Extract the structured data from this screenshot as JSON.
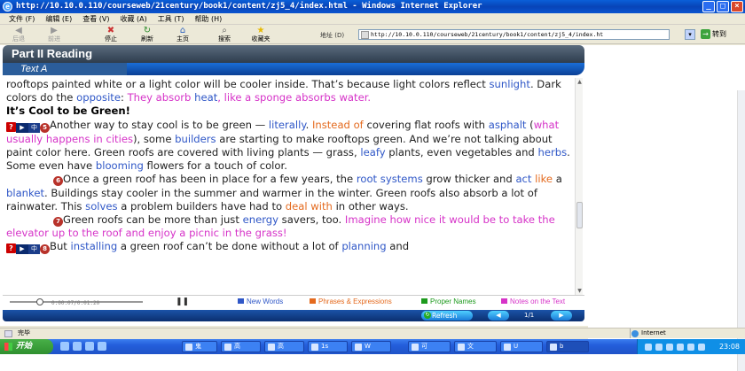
{
  "window": {
    "title": "http://10.10.0.110/courseweb/21century/book1/content/zj5_4/index.html - Windows Internet Explorer"
  },
  "menu": [
    "文件 (F)",
    "编辑 (E)",
    "查看 (V)",
    "收藏 (A)",
    "工具 (T)",
    "帮助 (H)"
  ],
  "toolbar": {
    "back": "后退",
    "forward": "前进",
    "stop": "停止",
    "refresh": "刷新",
    "home": "主页",
    "search": "搜索",
    "favorites": "收藏夹",
    "address_label": "地址 (D)",
    "address_value": "http://10.10.0.110/courseweb/21century/book1/content/zj5_4/index.ht",
    "go": "转到"
  },
  "lesson": {
    "part_title": "Part II Reading",
    "section_title": "Text A",
    "paragraphs": {
      "p1": {
        "a": "rooftops painted white or a light color will be cooler inside. That’s because light colors reflect ",
        "b_sunlight": "sunlight",
        "c": ". Dark colors do the ",
        "d_opposite": "opposite",
        "e": ": ",
        "f_magenta": "They absorb",
        "g": " ",
        "h_heat": "heat",
        "i_magenta2": ", like a sponge absorbs water."
      },
      "heading": "It’s Cool to be Green!",
      "p2": {
        "num": "5",
        "a": "Another way to stay cool is to be green — ",
        "b_literally": "literally",
        "c": ". ",
        "d_instead": "Instead of",
        "e": " covering flat roofs with ",
        "f_asphalt": "asphalt",
        "g": " (",
        "h_magenta": "what usually happens in cities",
        "i": "), some ",
        "j_builders": "builders",
        "k": " are starting to make rooftops green. And we’re not talking about paint color here. Green roofs are covered with living plants — grass, ",
        "l_leafy": "leafy",
        "m": " plants, even vegetables and ",
        "n_herbs": "herbs",
        "o": ". Some even have ",
        "p_blooming": "blooming",
        "q": " flowers for a touch of color."
      },
      "p3": {
        "num": "6",
        "a": "Once a green roof has been in place for a few years, the ",
        "b_root": "root systems",
        "c": " grow thicker and ",
        "d_act": "act",
        "e": " ",
        "f_like": "like",
        "g": " a ",
        "h_blanket": "blanket",
        "i": ". Buildings stay cooler in the summer and warmer in the winter. Green roofs also absorb a lot of rainwater. This ",
        "j_solves": "solves",
        "k": " a problem builders have had to ",
        "l_deal": "deal with",
        "m": " in other ways."
      },
      "p4": {
        "num": "7",
        "a": "Green roofs can be more than just ",
        "b_energy": "energy",
        "c": " savers, too. ",
        "d_magenta": "Imagine how nice it would be to take the elevator up to the roof and enjoy a picnic in the grass!"
      },
      "p5": {
        "a": "But ",
        "b_installing": "installing",
        "c": " a green roof can’t be done without a lot of ",
        "d_planning": "planning",
        "e": " and"
      }
    }
  },
  "audio": {
    "time": "0:00.07/0:01:20"
  },
  "legend": {
    "new_words": "New Words",
    "phrases": "Phrases & Expressions",
    "proper_names": "Proper Names",
    "notes": "Notes on the Text",
    "colors": {
      "new_words": "#2f57c7",
      "phrases": "#e46a1e",
      "proper_names": "#1d9a1d",
      "notes": "#d633c8"
    }
  },
  "nav": {
    "refresh": "Refresh",
    "page": "1/1"
  },
  "status": {
    "text": "完毕",
    "zone": "Internet"
  },
  "taskbar": {
    "start": "开始",
    "tasks": [
      "鬼",
      "高",
      "高",
      "1s",
      "W",
      "可",
      "文",
      "U",
      "b"
    ],
    "clock": "23:08"
  }
}
